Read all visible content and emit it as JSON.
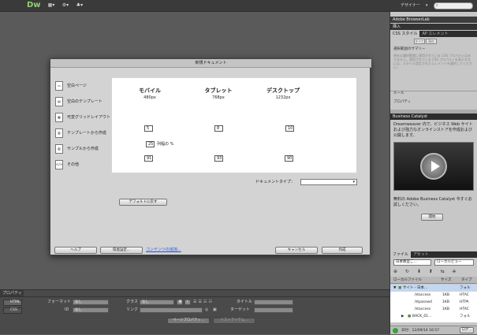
{
  "app": {
    "logo": "Dw",
    "workspace": "デザイナー",
    "toolbar_icons": [
      "▦▾",
      "⚙▾",
      "♣▾"
    ],
    "search_icon": "⌕"
  },
  "right": {
    "browserlab": "Adobe BrowserLab",
    "insert": "挿入",
    "css_tab": "CSS スタイル",
    "ap_tab": "AP エレメント",
    "css_buttons": [
      "すべて",
      "現在"
    ],
    "summary_title": "選択範囲のサマリー",
    "summary_text": "現在の選択範囲に適用されている CSS プロパティはありません。適用されている CSS プロパティを表示するには、スタイル設定されたエレメントを選択してください。",
    "rules": "ルール",
    "properties": "プロパティ",
    "bc_title": "Business Catalyst",
    "bc_text": "Dreamweaver 内で、ビジネス Web サイトおよび強力なオンラインストアを作成および公開します。",
    "bc_promo": "無料の Adobe Business Catalyst 今すぐお試しください。",
    "bc_start": "開始",
    "files_tab": "ファイル",
    "assets_tab": "アセット",
    "site_select": "日本教室ご…",
    "view_select": "ローカルビュー",
    "files_header": [
      "ローカルファイル",
      "サイズ",
      "タイプ"
    ],
    "files": [
      {
        "name": "サイト - 日本…",
        "size": "",
        "type": "フォル"
      },
      {
        "name": ".htaccess",
        "size": "1KB",
        "type": "HTAC"
      },
      {
        "name": ".htpasswd",
        "size": "1KB",
        "type": "HTPA"
      },
      {
        "name": ".htaccess",
        "size": "1KB",
        "type": "HTAC"
      },
      {
        "name": "BACK_01…",
        "size": "",
        "type": "フォル"
      }
    ],
    "status_date": "日付：12/09/14 16:57",
    "log_btn": "ログ..."
  },
  "dialog": {
    "title": "新規ドキュメント",
    "categories": [
      {
        "icon": "▭",
        "label": "空白ページ"
      },
      {
        "icon": "▤",
        "label": "空白のテンプレート"
      },
      {
        "icon": "▦",
        "label": "可変グリッドレイアウト"
      },
      {
        "icon": "▥",
        "label": "テンプレートから作成"
      },
      {
        "icon": "▨",
        "label": "サンプルから作成"
      },
      {
        "icon": "</>",
        "label": "その他"
      }
    ],
    "columns": [
      {
        "title": "モバイル",
        "px": "480px",
        "columns": "5",
        "width": "91"
      },
      {
        "title": "タブレット",
        "px": "768px",
        "columns": "8",
        "width": "93"
      },
      {
        "title": "デスクトップ",
        "px": "1232px",
        "columns": "10",
        "width": "90"
      }
    ],
    "gutter": {
      "value": "25",
      "label": "列幅の %"
    },
    "doctype_label": "ドキュメントタイプ：",
    "doctype_value": "▾",
    "reset_btn": "デフォルトに戻す",
    "help_btn": "ヘルプ",
    "prefs_btn": "環境設定...",
    "content_link": "コンテンツの追加...",
    "cancel_btn": "キャンセル",
    "create_btn": "作成"
  },
  "props": {
    "title": "プロパティ",
    "html_btn": "HTML",
    "css_btn": "CSS",
    "format_label": "フォーマット",
    "format_value": "なし",
    "class_label": "クラス",
    "class_value": "なし",
    "bold": "B",
    "italic": "I",
    "title_label": "タイトル",
    "id_label": "ID",
    "id_value": "なし",
    "link_label": "リンク",
    "target_label": "ターゲット",
    "page_props_btn": "ページプロパティ...",
    "list_items_btn": "リストアイテム..."
  }
}
